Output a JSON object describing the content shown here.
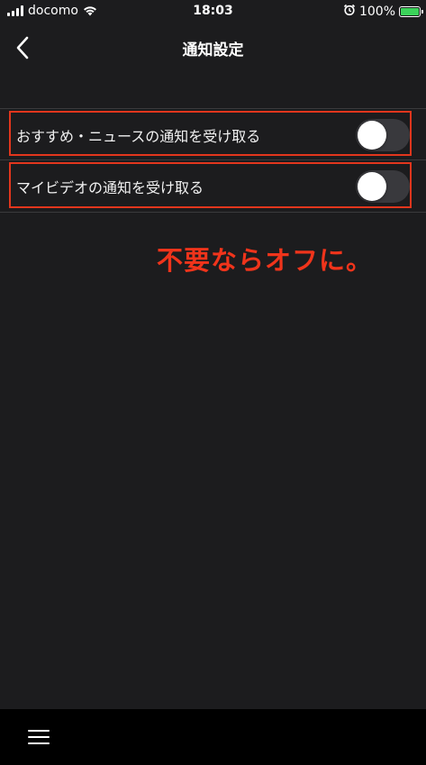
{
  "status_bar": {
    "carrier": "docomo",
    "time": "18:03",
    "battery": "100%",
    "icons": [
      "signal-icon",
      "wifi-icon",
      "alarm-icon",
      "battery-icon"
    ]
  },
  "nav": {
    "title": "通知設定",
    "back_icon": "chevron-left-icon"
  },
  "settings": [
    {
      "label": "おすすめ・ニュースの通知を受け取る",
      "enabled": false
    },
    {
      "label": "マイビデオの通知を受け取る",
      "enabled": false
    }
  ],
  "annotation": "不要ならオフに。",
  "bottom_bar": {
    "menu_icon": "hamburger-menu-icon"
  },
  "colors": {
    "background": "#1c1c1e",
    "highlight": "#e2361d",
    "annotation": "#f0341b",
    "toggle_off": "#39393d",
    "battery": "#3bd35a"
  }
}
